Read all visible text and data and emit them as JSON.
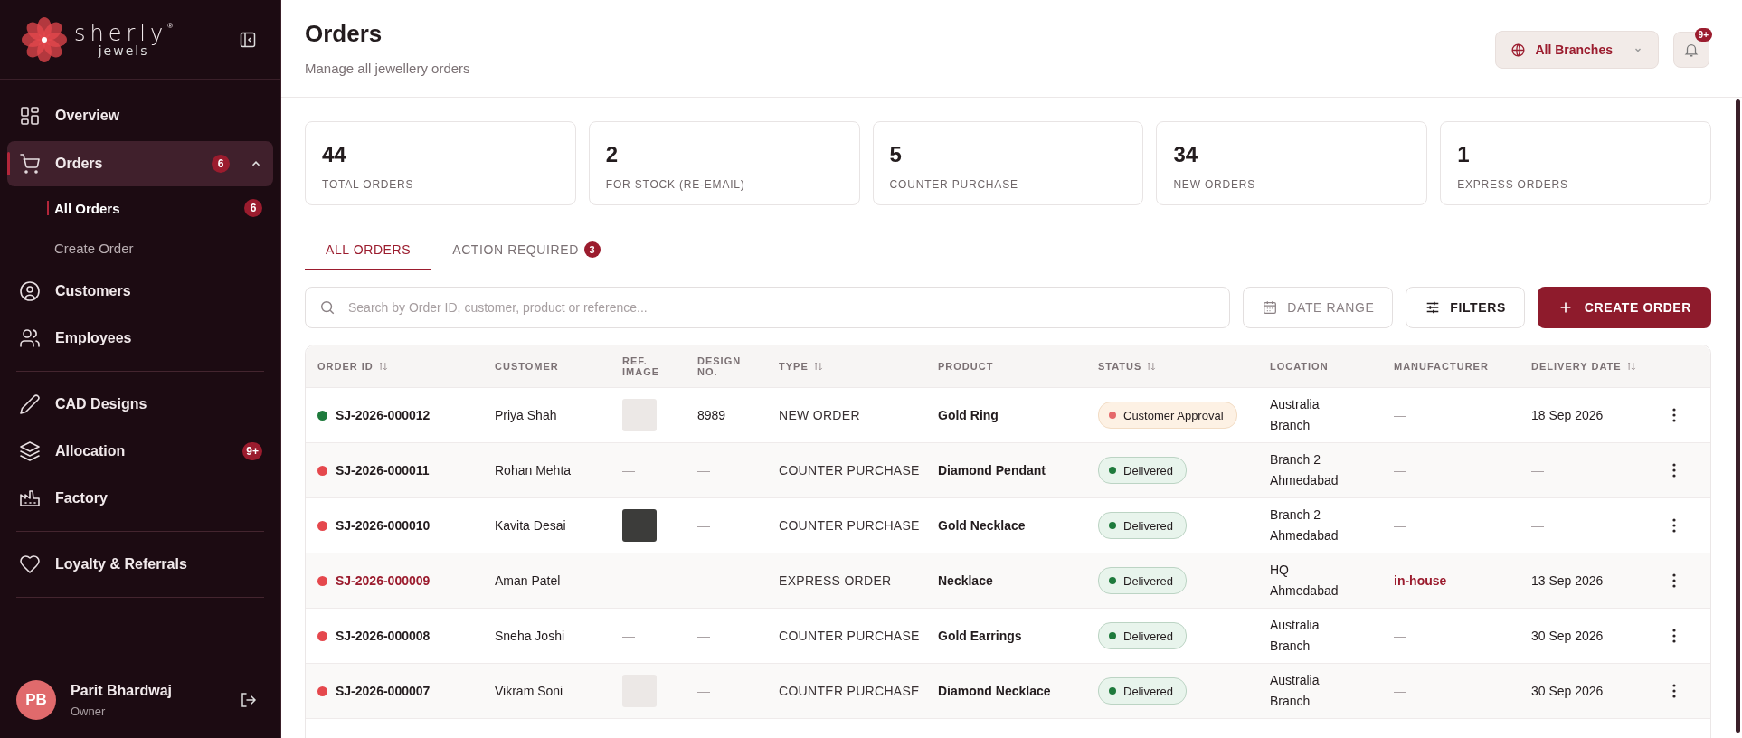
{
  "sidebar": {
    "logo": {
      "name": "sherly",
      "mark": "®",
      "tagline": "jewels"
    },
    "nav_groups": [
      [
        {
          "label": "Overview",
          "selected": false
        },
        {
          "label": "Orders",
          "selected": true,
          "badge": "6",
          "expanded": true,
          "children": [
            {
              "label": "All Orders",
              "selected": true,
              "badge": "6"
            },
            {
              "label": "Create Order",
              "selected": false
            }
          ]
        },
        {
          "label": "Customers",
          "selected": false
        },
        {
          "label": "Employees",
          "selected": false
        }
      ],
      [
        {
          "label": "CAD Designs",
          "selected": false
        },
        {
          "label": "Allocation",
          "selected": false,
          "badge": "9+"
        },
        {
          "label": "Factory",
          "selected": false
        }
      ],
      [
        {
          "label": "Loyalty & Referrals",
          "selected": false
        }
      ]
    ],
    "user": {
      "initials": "PB",
      "name": "Parit Bhardwaj",
      "role": "Owner"
    }
  },
  "header": {
    "title": "Orders",
    "subtitle": "Manage all jewellery orders",
    "branch_selector": "All Branches",
    "notifications_badge": "9+"
  },
  "stats": [
    {
      "value": "44",
      "label": "TOTAL ORDERS"
    },
    {
      "value": "2",
      "label": "FOR STOCK (RE-EMAIL)"
    },
    {
      "value": "5",
      "label": "COUNTER PURCHASE"
    },
    {
      "value": "34",
      "label": "NEW ORDERS"
    },
    {
      "value": "1",
      "label": "EXPRESS ORDERS"
    }
  ],
  "tabs": [
    {
      "label": "ALL ORDERS",
      "selected": true
    },
    {
      "label": "ACTION REQUIRED",
      "selected": false,
      "badge": "3"
    }
  ],
  "toolbar": {
    "search": {
      "placeholder": "Search by Order ID, customer, product or reference..."
    },
    "date_range": "DATE RANGE",
    "filters": "FILTERS",
    "create": "CREATE ORDER"
  },
  "table": {
    "columns": [
      {
        "label": "ORDER ID",
        "sortable": true
      },
      {
        "label": "CUSTOMER",
        "sortable": false
      },
      {
        "label": "REF. IMAGE",
        "sortable": false
      },
      {
        "label": "DESIGN NO.",
        "sortable": false
      },
      {
        "label": "TYPE",
        "sortable": true
      },
      {
        "label": "PRODUCT",
        "sortable": false
      },
      {
        "label": "STATUS",
        "sortable": true
      },
      {
        "label": "LOCATION",
        "sortable": false
      },
      {
        "label": "MANUFACTURER",
        "sortable": false
      },
      {
        "label": "DELIVERY DATE",
        "sortable": true
      }
    ],
    "rows": [
      {
        "order_id": "SJ-2026-000012",
        "color": "#1e7a3c",
        "highlighted": false,
        "customer": "Priya Shah",
        "ref_image": {
          "kind": "light-photo"
        },
        "design_no": "8989",
        "type": "NEW ORDER",
        "product": "Gold Ring",
        "status": {
          "label": "Customer Approval",
          "kind": "pending"
        },
        "location": "Australia Branch",
        "manufacturer": {
          "text": "—",
          "kind": "empty"
        },
        "delivery_date": "18 Sep 2026"
      },
      {
        "order_id": "SJ-2026-000011",
        "color": "#e5484d",
        "highlighted": false,
        "customer": "Rohan Mehta",
        "ref_image": {
          "kind": "none",
          "text": "—"
        },
        "design_no": "—",
        "type": "COUNTER PURCHASE",
        "product": "Diamond Pendant",
        "status": {
          "label": "Delivered",
          "kind": "delivered"
        },
        "location": "Branch 2 Ahmedabad",
        "manufacturer": {
          "text": "—",
          "kind": "empty"
        },
        "delivery_date": "—"
      },
      {
        "order_id": "SJ-2026-000010",
        "color": "#e5484d",
        "highlighted": false,
        "customer": "Kavita Desai",
        "ref_image": {
          "kind": "dark-photo"
        },
        "design_no": "—",
        "type": "COUNTER PURCHASE",
        "product": "Gold Necklace",
        "status": {
          "label": "Delivered",
          "kind": "delivered"
        },
        "location": "Branch 2 Ahmedabad",
        "manufacturer": {
          "text": "—",
          "kind": "empty"
        },
        "delivery_date": "—"
      },
      {
        "order_id": "SJ-2026-000009",
        "color": "#e5484d",
        "highlighted": true,
        "customer": "Aman Patel",
        "ref_image": {
          "kind": "none",
          "text": "—"
        },
        "design_no": "—",
        "type": "EXPRESS ORDER",
        "product": "Necklace",
        "status": {
          "label": "Delivered",
          "kind": "delivered"
        },
        "location": "HQ Ahmedabad",
        "manufacturer": {
          "text": "in-house",
          "kind": "link"
        },
        "delivery_date": "13 Sep 2026"
      },
      {
        "order_id": "SJ-2026-000008",
        "color": "#e5484d",
        "highlighted": false,
        "customer": "Sneha Joshi",
        "ref_image": {
          "kind": "none",
          "text": "—"
        },
        "design_no": "—",
        "type": "COUNTER PURCHASE",
        "product": "Gold Earrings",
        "status": {
          "label": "Delivered",
          "kind": "delivered"
        },
        "location": "Australia Branch",
        "manufacturer": {
          "text": "—",
          "kind": "empty"
        },
        "delivery_date": "30 Sep 2026"
      },
      {
        "order_id": "SJ-2026-000007",
        "color": "#e5484d",
        "highlighted": false,
        "customer": "Vikram Soni",
        "ref_image": {
          "kind": "light-photo"
        },
        "design_no": "—",
        "type": "COUNTER PURCHASE",
        "product": "Diamond Necklace",
        "status": {
          "label": "Delivered",
          "kind": "delivered"
        },
        "location": "Australia Branch",
        "manufacturer": {
          "text": "—",
          "kind": "empty"
        },
        "delivery_date": "30 Sep 2026"
      }
    ]
  }
}
